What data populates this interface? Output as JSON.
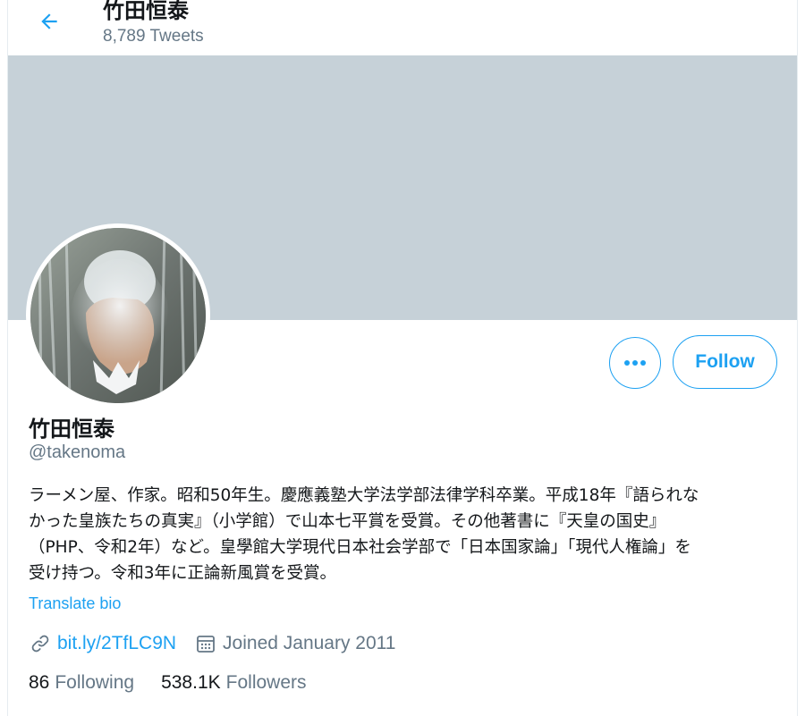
{
  "header": {
    "title": "竹田恒泰",
    "tweet_count": "8,789 Tweets"
  },
  "profile": {
    "name": "竹田恒泰",
    "handle": "@takenoma",
    "bio_lines": [
      "ラーメン屋、作家。昭和50年生。慶應義塾大学法学部法律学科卒業。平成18年『語られな",
      "かった皇族たちの真実』（小学館）で山本七平賞を受賞。その他著書に『天皇の国史』",
      "（PHP、令和2年）など。皇學館大学現代日本社会学部で「日本国家論」「現代人権論」を",
      "受け持つ。令和3年に正論新風賞を受賞。"
    ],
    "translate_label": "Translate bio",
    "website": "bit.ly/2TfLC9N",
    "joined": "Joined January 2011",
    "following_count": "86",
    "following_label": "Following",
    "followers_count": "538.1K",
    "followers_label": "Followers"
  },
  "actions": {
    "follow_label": "Follow",
    "more_icon": "ellipsis-icon"
  },
  "colors": {
    "accent": "#1da1f2",
    "banner": "#c6d1d8",
    "secondary_text": "#657786"
  }
}
